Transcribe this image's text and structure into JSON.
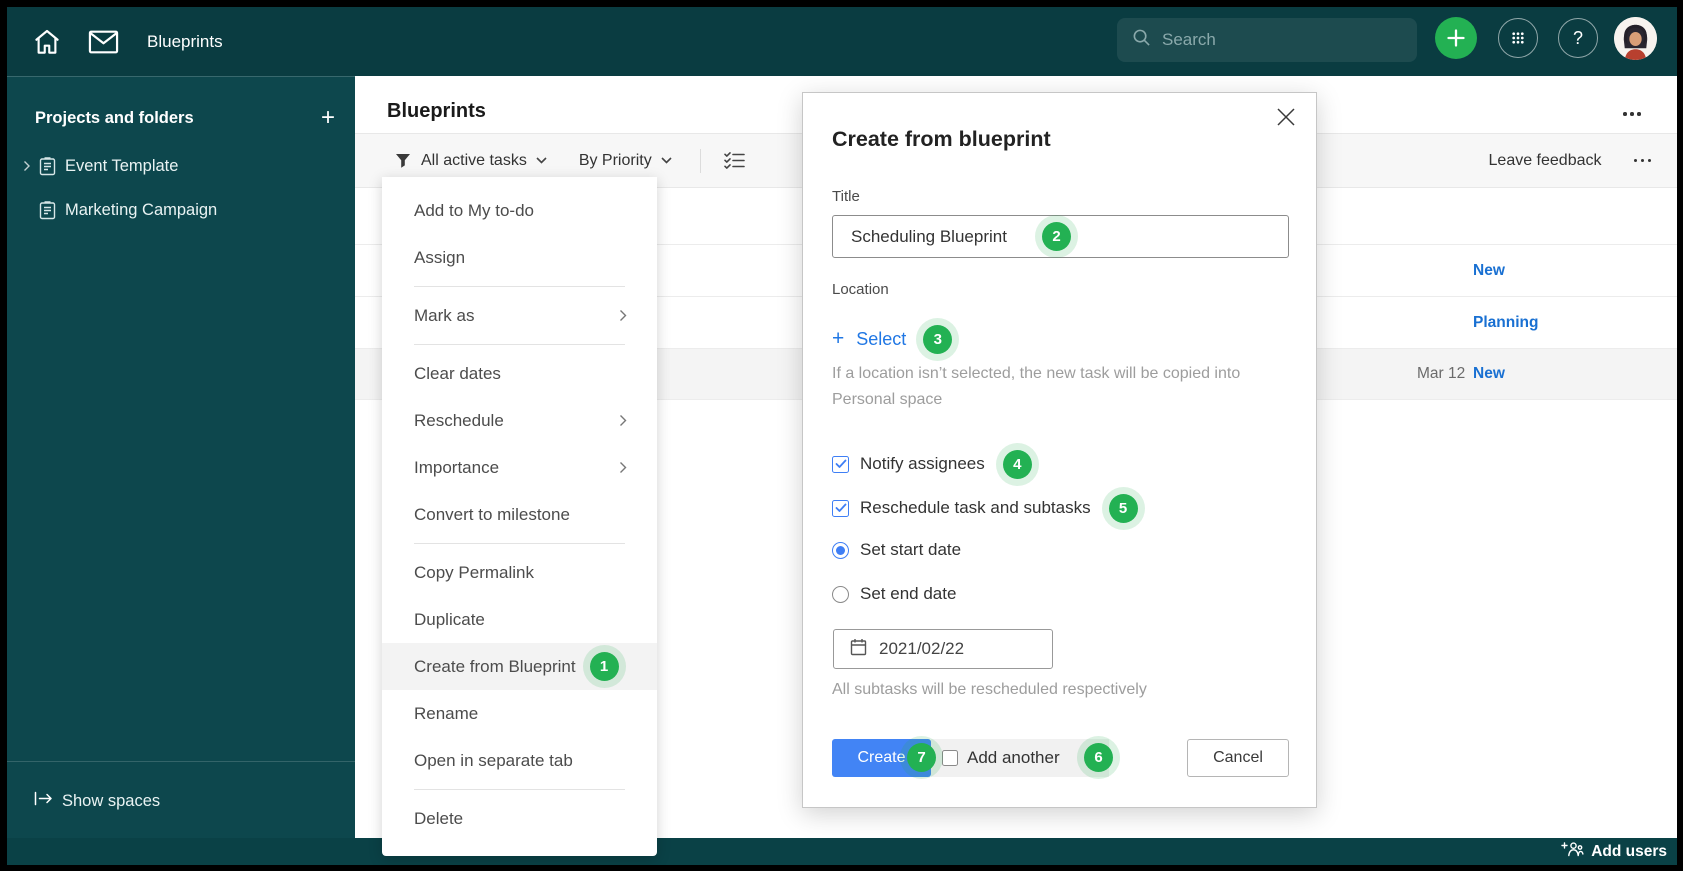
{
  "topbar": {
    "title": "Blueprints",
    "search_placeholder": "Search"
  },
  "sidebar": {
    "section_title": "Projects and folders",
    "items": [
      {
        "label": "Event Template"
      },
      {
        "label": "Marketing Campaign"
      }
    ],
    "show_spaces": "Show spaces"
  },
  "main": {
    "title": "Blueprints",
    "filters": {
      "tasks": "All active tasks",
      "sort": "By Priority"
    },
    "leave_feedback": "Leave feedback",
    "rows": [
      {
        "date": "",
        "status": ""
      },
      {
        "date": "",
        "status": "New"
      },
      {
        "date": "",
        "status": "Planning"
      },
      {
        "date": "Mar 12",
        "status": "New"
      }
    ]
  },
  "menu": {
    "items": [
      {
        "label": "Add to My to-do"
      },
      {
        "label": "Assign"
      },
      {
        "label": "Mark as",
        "submenu": true
      },
      {
        "label": "Clear dates"
      },
      {
        "label": "Reschedule",
        "submenu": true
      },
      {
        "label": "Importance",
        "submenu": true
      },
      {
        "label": "Convert to milestone"
      },
      {
        "label": "Copy Permalink"
      },
      {
        "label": "Duplicate"
      },
      {
        "label": "Create from Blueprint",
        "highlighted": true,
        "badge": "1"
      },
      {
        "label": "Rename"
      },
      {
        "label": "Open in separate tab"
      },
      {
        "label": "Delete"
      }
    ]
  },
  "modal": {
    "title": "Create from blueprint",
    "title_label": "Title",
    "title_value": "Scheduling Blueprint",
    "title_badge": "2",
    "location_label": "Location",
    "select_label": "Select",
    "select_badge": "3",
    "location_hint": "If a location isn’t selected, the new task will be copied into Personal space",
    "notify_label": "Notify assignees",
    "notify_badge": "4",
    "reschedule_label": "Reschedule task and subtasks",
    "reschedule_badge": "5",
    "start_date_label": "Set start date",
    "end_date_label": "Set end date",
    "date_value": "2021/02/22",
    "date_hint": "All subtasks will be rescheduled respectively",
    "create_label": "Create",
    "create_badge": "7",
    "add_another_label": "Add another",
    "add_another_badge": "6",
    "cancel_label": "Cancel"
  },
  "bottombar": {
    "add_users": "Add users"
  },
  "colors": {
    "topbar_teal": "#0a3c41",
    "sidebar_teal": "#0d474d",
    "accent_green": "#23b153",
    "link_blue": "#2077e4",
    "status_blue": "#1970d2",
    "create_blue": "#4284f5"
  }
}
